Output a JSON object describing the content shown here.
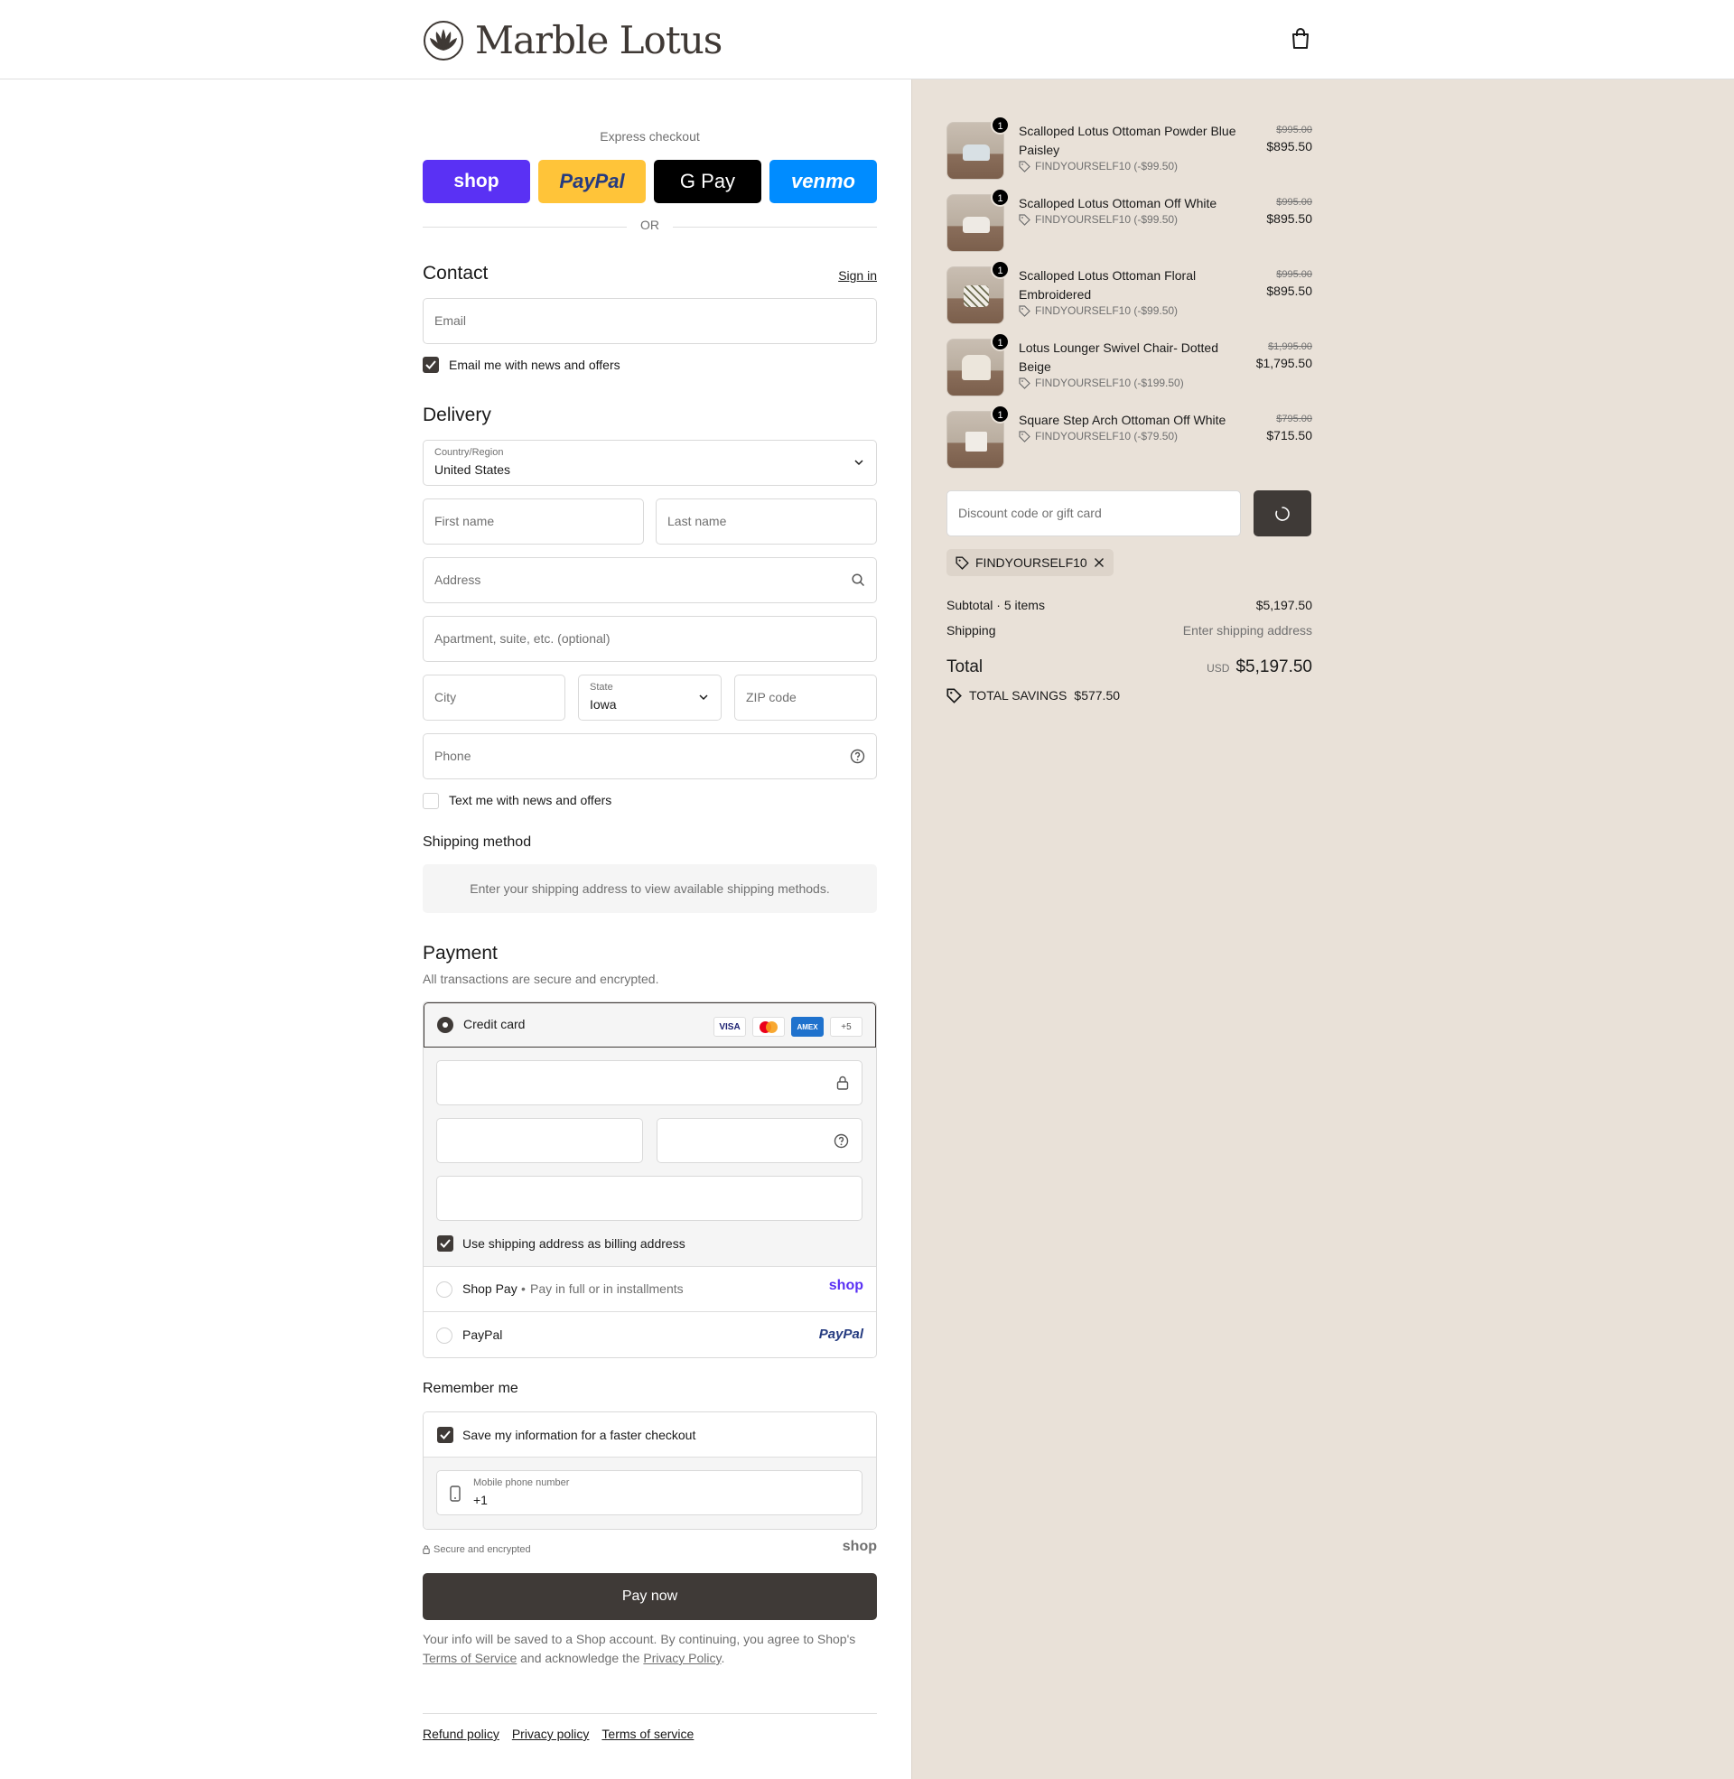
{
  "brand": {
    "name": "Marble Lotus"
  },
  "express": {
    "label": "Express checkout",
    "buttons": [
      "shop",
      "PayPal",
      "G Pay",
      "venmo"
    ],
    "colors": {
      "shop": "#5a31f4",
      "paypal": "#ffc439",
      "gpay": "#000000",
      "venmo": "#008cff"
    },
    "or": "OR"
  },
  "contact": {
    "title": "Contact",
    "signin": "Sign in",
    "email_placeholder": "Email",
    "news_checkbox": "Email me with news and offers"
  },
  "delivery": {
    "title": "Delivery",
    "country_label": "Country/Region",
    "country_value": "United States",
    "first_name": "First name",
    "last_name": "Last name",
    "address": "Address",
    "apartment": "Apartment, suite, etc. (optional)",
    "city": "City",
    "state_label": "State",
    "state_value": "Iowa",
    "zip": "ZIP code",
    "phone": "Phone",
    "text_checkbox": "Text me with news and offers"
  },
  "shipping_method": {
    "title": "Shipping method",
    "empty": "Enter your shipping address to view available shipping methods."
  },
  "payment": {
    "title": "Payment",
    "subtitle": "All transactions are secure and encrypted.",
    "credit_card": "Credit card",
    "card_logos": [
      "VISA",
      "MC",
      "AMEX",
      "+5"
    ],
    "billing_checkbox": "Use shipping address as billing address",
    "shop_pay": "Shop Pay",
    "shop_pay_sub": "Pay in full or in installments",
    "shop_pay_logo": "shop",
    "paypal": "PayPal",
    "paypal_logo": "PayPal"
  },
  "remember": {
    "title": "Remember me",
    "save_checkbox": "Save my information for a faster checkout",
    "mobile_label": "Mobile phone number",
    "mobile_value": "+1",
    "secure": "Secure and encrypted",
    "shop_logo": "shop"
  },
  "pay_now": "Pay now",
  "legal": {
    "text1": "Your info will be saved to a Shop account. By continuing, you agree to Shop's",
    "tos": "Terms of Service",
    "text2": "and acknowledge the",
    "privacy": "Privacy Policy",
    "end": "."
  },
  "footer": [
    "Refund policy",
    "Privacy policy",
    "Terms of service"
  ],
  "cart": {
    "items": [
      {
        "name": "Scalloped Lotus Ottoman Powder Blue Paisley",
        "qty": "1",
        "discount": "FINDYOURSELF10 (-$99.50)",
        "old_price": "$995.00",
        "price": "$895.50"
      },
      {
        "name": "Scalloped Lotus Ottoman Off White",
        "qty": "1",
        "discount": "FINDYOURSELF10 (-$99.50)",
        "old_price": "$995.00",
        "price": "$895.50"
      },
      {
        "name": "Scalloped Lotus Ottoman Floral Embroidered",
        "qty": "1",
        "discount": "FINDYOURSELF10 (-$99.50)",
        "old_price": "$995.00",
        "price": "$895.50"
      },
      {
        "name": "Lotus Lounger Swivel Chair- Dotted Beige",
        "qty": "1",
        "discount": "FINDYOURSELF10 (-$199.50)",
        "old_price": "$1,995.00",
        "price": "$1,795.50"
      },
      {
        "name": "Square Step Arch Ottoman Off White",
        "qty": "1",
        "discount": "FINDYOURSELF10 (-$79.50)",
        "old_price": "$795.00",
        "price": "$715.50"
      }
    ],
    "discount_placeholder": "Discount code or gift card",
    "applied_code": "FINDYOURSELF10",
    "subtotal_label": "Subtotal · 5 items",
    "subtotal": "$5,197.50",
    "shipping_label": "Shipping",
    "shipping_value": "Enter shipping address",
    "total_label": "Total",
    "currency": "USD",
    "total": "$5,197.50",
    "savings_label": "TOTAL SAVINGS",
    "savings": "$577.50"
  }
}
